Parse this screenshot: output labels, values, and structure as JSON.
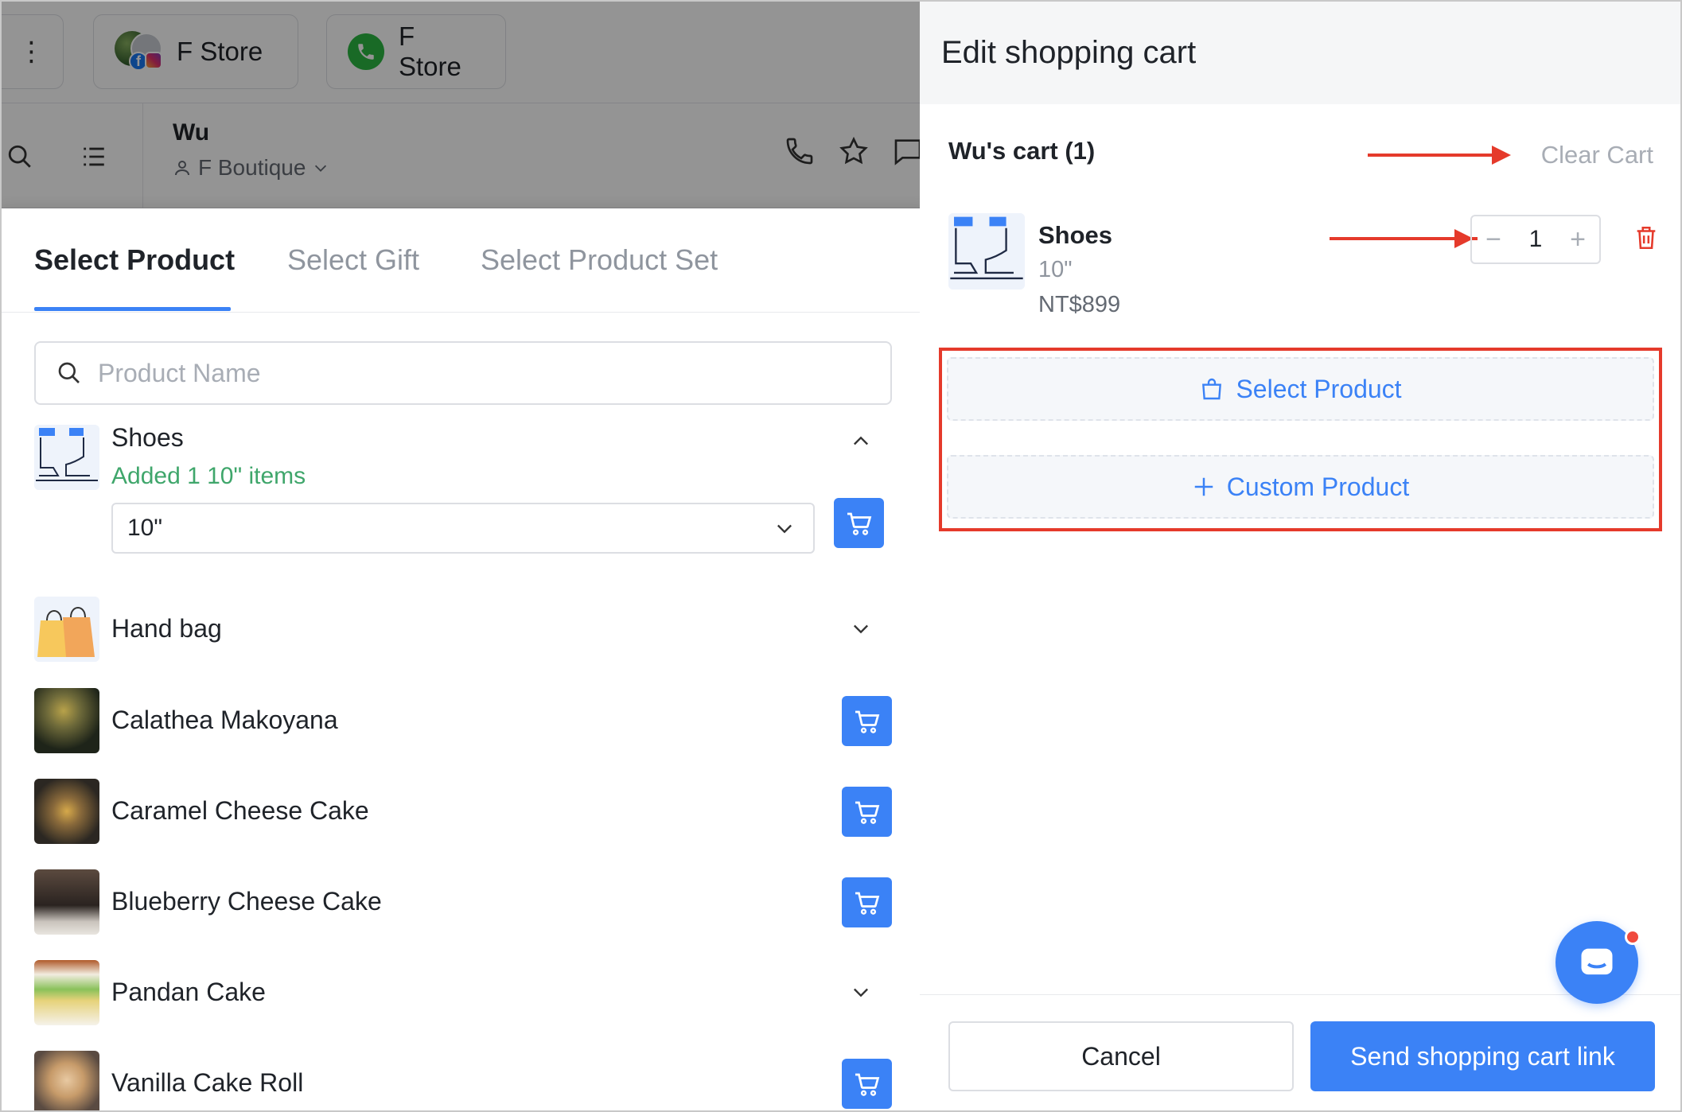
{
  "background": {
    "more_glyph": "⋮",
    "channels": [
      {
        "label": "F Store",
        "icon": "facebook-instagram-avatar-icon"
      },
      {
        "label": "F Store",
        "icon": "whatsapp-phone-icon"
      }
    ],
    "contact": {
      "name": "Wu",
      "store": "F Boutique"
    }
  },
  "product_popup": {
    "tabs": [
      {
        "label": "Select Product",
        "active": true
      },
      {
        "label": "Select Gift",
        "active": false
      },
      {
        "label": "Select Product Set",
        "active": false
      }
    ],
    "search": {
      "placeholder": "Product Name",
      "value": ""
    },
    "products": [
      {
        "name": "Shoes",
        "expanded": true,
        "added_note": "Added 1 10\" items",
        "selected_variant": "10\""
      },
      {
        "name": "Hand bag",
        "has_variants": true
      },
      {
        "name": "Calathea Makoyana",
        "has_variants": false
      },
      {
        "name": "Caramel Cheese Cake",
        "has_variants": false
      },
      {
        "name": "Blueberry Cheese Cake",
        "has_variants": false
      },
      {
        "name": "Pandan Cake",
        "has_variants": true
      },
      {
        "name": "Vanilla Cake Roll",
        "has_variants": false
      }
    ]
  },
  "cart_drawer": {
    "title": "Edit shopping cart",
    "cart_label": "Wu's cart (1)",
    "clear_cart": "Clear Cart",
    "item": {
      "name": "Shoes",
      "variant": "10\"",
      "price": "NT$899",
      "quantity": "1",
      "minus": "−",
      "plus": "+"
    },
    "select_product": "Select Product",
    "custom_product": "Custom Product",
    "cancel": "Cancel",
    "send": "Send shopping cart link"
  },
  "colors": {
    "accent": "#3b82f6",
    "annotation_red": "#e53a2b",
    "success_green": "#3fa66b"
  }
}
